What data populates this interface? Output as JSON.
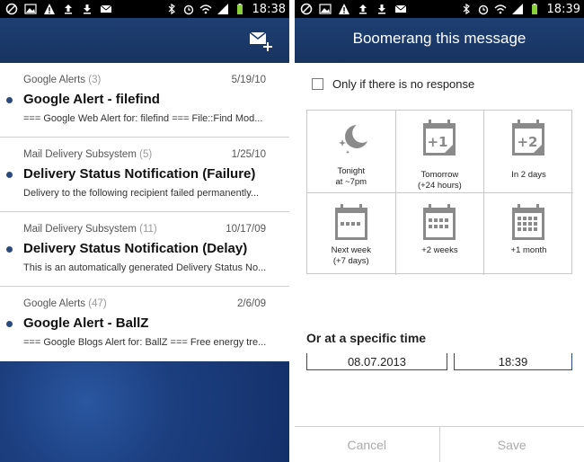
{
  "left": {
    "status_time": "18:38",
    "mails": [
      {
        "sender": "Google Alerts",
        "count": "(3)",
        "date": "5/19/10",
        "subject": "Google Alert - filefind",
        "preview": "=== Google Web Alert for: filefind === File::Find Mod..."
      },
      {
        "sender": "Mail Delivery Subsystem",
        "count": "(5)",
        "date": "1/25/10",
        "subject": "Delivery Status Notification (Failure)",
        "preview": "Delivery to the following recipient failed permanently..."
      },
      {
        "sender": "Mail Delivery Subsystem",
        "count": "(11)",
        "date": "10/17/09",
        "subject": "Delivery Status Notification (Delay)",
        "preview": "This is an automatically generated Delivery Status No..."
      },
      {
        "sender": "Google Alerts",
        "count": "(47)",
        "date": "2/6/09",
        "subject": "Google Alert - BallZ",
        "preview": "=== Google Blogs Alert for: BallZ === Free energy tre..."
      }
    ]
  },
  "right": {
    "status_time": "18:39",
    "title": "Boomerang this message",
    "checkbox_label": "Only if there is no response",
    "options": [
      {
        "line1": "Tonight",
        "line2": "at ~7pm",
        "icon": "moon-stars-icon"
      },
      {
        "line1": "Tomorrow",
        "line2": "(+24 hours)",
        "icon": "calendar-plus1-icon",
        "badge": "+1"
      },
      {
        "line1": "In 2 days",
        "line2": "",
        "icon": "calendar-plus2-icon",
        "badge": "+2"
      },
      {
        "line1": "Next week",
        "line2": "(+7 days)",
        "icon": "calendar-week-icon"
      },
      {
        "line1": "+2 weeks",
        "line2": "",
        "icon": "calendar-2weeks-icon"
      },
      {
        "line1": "+1 month",
        "line2": "",
        "icon": "calendar-month-icon"
      }
    ],
    "specific_title": "Or at a specific time",
    "date_value": "08.07.2013",
    "time_value": "18:39",
    "cancel_label": "Cancel",
    "save_label": "Save"
  }
}
